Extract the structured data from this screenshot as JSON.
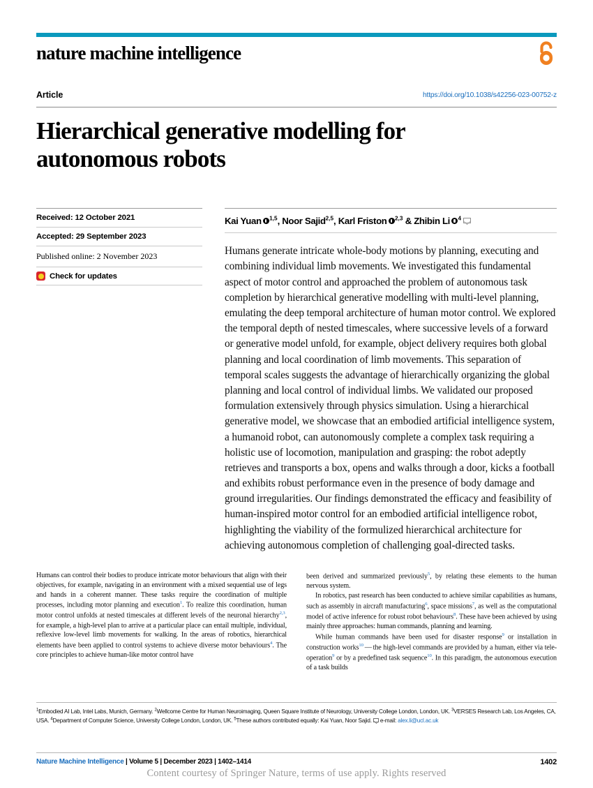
{
  "journal": {
    "name": "nature machine intelligence",
    "rule_color": "#0b99bd",
    "open_access_icon": "open-access-lock-icon",
    "open_access_color": "#f08020"
  },
  "header": {
    "article_type": "Article",
    "doi": "https://doi.org/10.1038/s42256-023-00752-z",
    "doi_color": "#1a6ebd"
  },
  "title": "Hierarchical generative modelling for autonomous robots",
  "sidebar": {
    "received": "Received: 12 October 2021",
    "accepted": "Accepted: 29 September 2023",
    "published": "Published online: 2 November 2023",
    "check_updates": "Check for updates",
    "crossmark_icon": "crossmark-icon"
  },
  "authors": {
    "line": "Kai Yuan, Noor Sajid, Karl Friston & Zhibin Li",
    "list": [
      {
        "name": "Kai Yuan",
        "orcid": true,
        "affiliations": "1,5",
        "separator": ", "
      },
      {
        "name": "Noor Sajid",
        "orcid": false,
        "affiliations": "2,5",
        "separator": ", "
      },
      {
        "name": "Karl Friston",
        "orcid": true,
        "affiliations": "2,3",
        "separator": " & "
      },
      {
        "name": "Zhibin Li",
        "orcid": true,
        "affiliations": "4",
        "separator": ""
      }
    ],
    "corresponding_icon": "envelope-icon"
  },
  "abstract": "Humans generate intricate whole-body motions by planning, executing and combining individual limb movements. We investigated this fundamental aspect of motor control and approached the problem of autonomous task completion by hierarchical generative modelling with multi-level planning, emulating the deep temporal architecture of human motor control. We explored the temporal depth of nested timescales, where successive levels of a forward or generative model unfold, for example, object delivery requires both global planning and local coordination of limb movements. This separation of temporal scales suggests the advantage of hierarchically organizing the global planning and local control of individual limbs. We validated our proposed formulation extensively through physics simulation. Using a hierarchical generative model, we showcase that an embodied artificial intelligence system, a humanoid robot, can autonomously complete a complex task requiring a holistic use of locomotion, manipulation and grasping: the robot adeptly retrieves and transports a box, opens and walks through a door, kicks a football and exhibits robust performance even in the presence of body damage and ground irregularities. Our findings demonstrated the efficacy and feasibility of human-inspired motor control for an embodied artificial intelligence robot, highlighting the viability of the formulized hierarchical architecture for achieving autonomous completion of challenging goal-directed tasks.",
  "body": {
    "left_column": [
      {
        "indent": false,
        "parts": [
          {
            "text": "Humans can control their bodies to produce intricate motor behaviours that align with their objectives, for example, navigating in an environment with a mixed sequential use of legs and hands in a coherent manner. These tasks require the coordination of multiple processes, including motor planning and execution"
          },
          {
            "sup": "1"
          },
          {
            "text": ". To realize this coordination, human motor control unfolds at nested timescales at different levels of the neuronal hierarchy"
          },
          {
            "sup": "2,3"
          },
          {
            "text": ", for example, a high-level plan to arrive at a particular place can entail multiple, individual, reflexive low-level limb movements for walking. In the areas of robotics, hierarchical elements have been applied to control systems to achieve diverse motor behaviours"
          },
          {
            "sup": "4"
          },
          {
            "text": ". The core principles to achieve human-like motor control have"
          }
        ]
      }
    ],
    "right_column": [
      {
        "indent": false,
        "parts": [
          {
            "text": "been derived and summarized previously"
          },
          {
            "sup": "5"
          },
          {
            "text": ", by relating these elements to the human nervous system."
          }
        ]
      },
      {
        "indent": true,
        "parts": [
          {
            "text": "In robotics, past research has been conducted to achieve similar capabilities as humans, such as assembly in aircraft manufacturing"
          },
          {
            "sup": "6"
          },
          {
            "text": ", space missions"
          },
          {
            "sup": "7"
          },
          {
            "text": ", as well as the computational model of active inference for robust robot behaviours"
          },
          {
            "sup": "8"
          },
          {
            "text": ". These have been achieved by using mainly three approaches: human commands, planning and learning."
          }
        ]
      },
      {
        "indent": true,
        "parts": [
          {
            "text": "While human commands have been used for disaster response"
          },
          {
            "sup": "9"
          },
          {
            "text": " or installation in construction works"
          },
          {
            "sup": "10"
          },
          {
            "text": " — the high-level commands are provided by a human, either via tele-operation"
          },
          {
            "sup": "9"
          },
          {
            "text": " or by a predefined task sequence"
          },
          {
            "sup": "10"
          },
          {
            "text": ". In this paradigm, the autonomous execution of a task builds"
          }
        ]
      }
    ]
  },
  "affiliations": {
    "items": [
      {
        "marker": "1",
        "text": "Embodied AI Lab, Intel Labs, Munich, Germany. "
      },
      {
        "marker": "2",
        "text": "Wellcome Centre for Human Neuroimaging, Queen Square Institute of Neurology,  University College London, London, UK. "
      },
      {
        "marker": "3",
        "text": "VERSES Research Lab, Los Angeles, CA, USA. "
      },
      {
        "marker": "4",
        "text": "Department of Computer Science, University College London, London, UK. "
      },
      {
        "marker": "5",
        "text": "These authors contributed equally: Kai Yuan, Noor Sajid. "
      }
    ],
    "email_label": "e-mail: ",
    "email": "alex.li@ucl.ac.uk",
    "email_icon": "envelope-icon"
  },
  "footer": {
    "journal_name": "Nature Machine Intelligence",
    "meta": " | Volume 5 | December 2023 | 1402–1414",
    "page_number": "1402",
    "watermark": "Content courtesy of Springer Nature, terms of use apply. Rights reserved"
  }
}
